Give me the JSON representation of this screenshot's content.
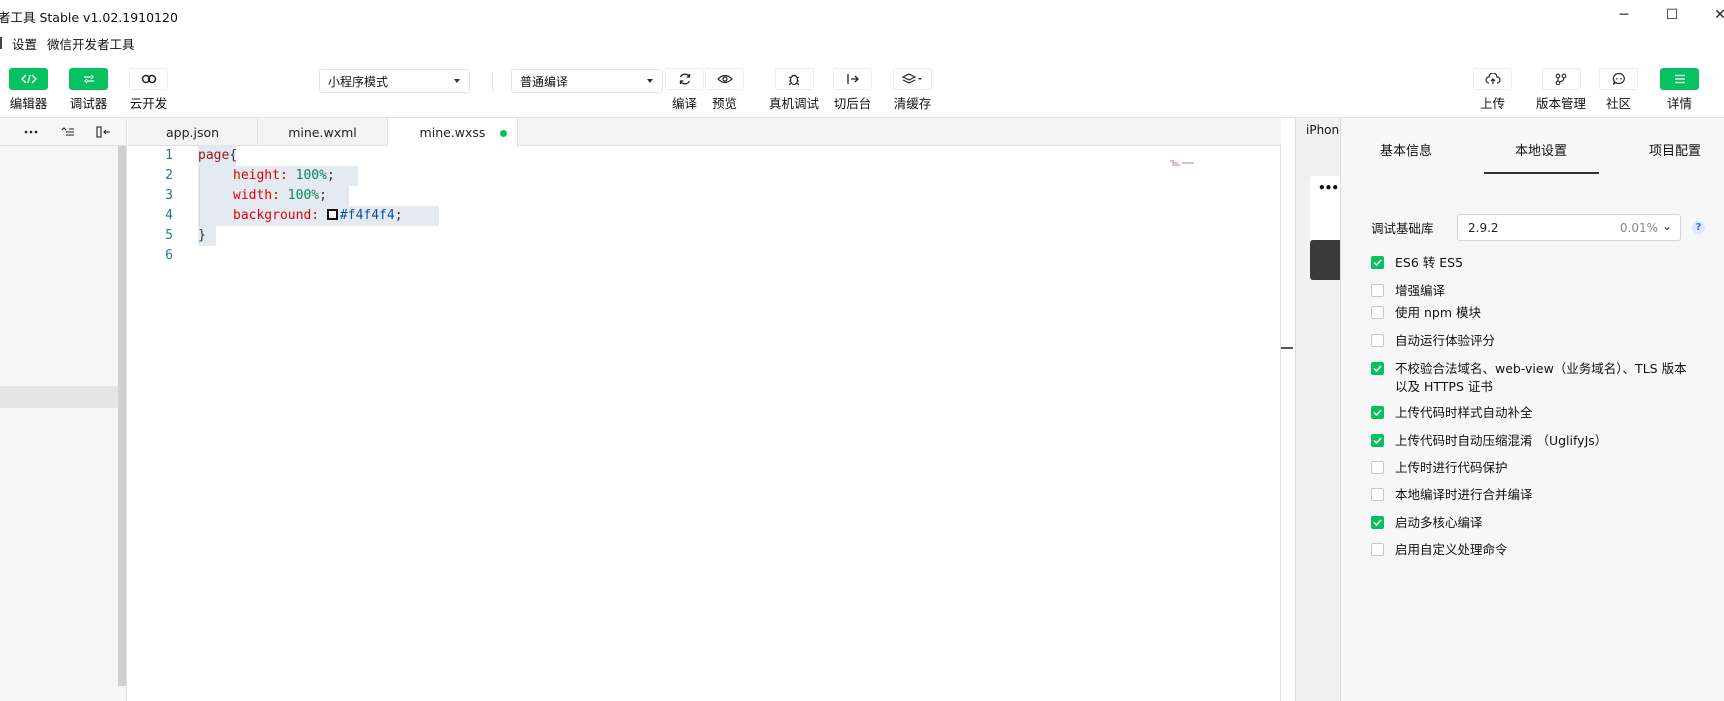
{
  "window": {
    "title": "者工具 Stable v1.02.1910120",
    "controls": {
      "minimize": "─",
      "maximize": "☐",
      "close": "✕"
    }
  },
  "menu": {
    "items": [
      "设置",
      "微信开发者工具"
    ]
  },
  "toolbar": {
    "editor_label": "编辑器",
    "debugger_label": "调试器",
    "cloud_label": "云开发",
    "mode_select": "小程序模式",
    "compile_select": "普通编译",
    "compile_label": "编译",
    "preview_label": "预览",
    "remote_debug_label": "真机调试",
    "background_label": "切后台",
    "clear_cache_label": "清缓存",
    "upload_label": "上传",
    "version_label": "版本管理",
    "community_label": "社区",
    "details_label": "详情",
    "accent": "#07c160"
  },
  "editor": {
    "tabs": [
      {
        "label": "app.json"
      },
      {
        "label": "mine.wxml"
      },
      {
        "label": "mine.wxss",
        "modified": true
      }
    ],
    "lines": [
      {
        "n": "1",
        "selector": "page",
        "open": "{"
      },
      {
        "n": "2",
        "prop": "height:",
        "val": "100%",
        "end": ";"
      },
      {
        "n": "3",
        "prop": "width:",
        "val": "100%",
        "end": ";"
      },
      {
        "n": "4",
        "prop": "background:",
        "val": "#f4f4f4",
        "end": ";"
      },
      {
        "n": "5",
        "close": "}"
      },
      {
        "n": "6"
      }
    ]
  },
  "simulator": {
    "device_tab": "iPhone",
    "status_dots": "•••"
  },
  "details": {
    "tabs": [
      "基本信息",
      "本地设置",
      "项目配置"
    ],
    "active_tab": "本地设置",
    "lib_label": "调试基础库",
    "lib_version": "2.9.2",
    "lib_percent": "0.01%",
    "help": "?",
    "options": [
      {
        "label": "ES6 转 ES5",
        "checked": true
      },
      {
        "label": "增强编译",
        "checked": false
      },
      {
        "label": "使用 npm 模块",
        "checked": false
      },
      {
        "label": "自动运行体验评分",
        "checked": false
      },
      {
        "label": "不校验合法域名、web-view（业务域名）、TLS 版本以及 HTTPS 证书",
        "checked": true
      },
      {
        "label": "上传代码时样式自动补全",
        "checked": true
      },
      {
        "label": "上传代码时自动压缩混淆 （UglifyJs）",
        "checked": true
      },
      {
        "label": "上传时进行代码保护",
        "checked": false
      },
      {
        "label": "本地编译时进行合并编译",
        "checked": false
      },
      {
        "label": "启动多核心编译",
        "checked": true
      },
      {
        "label": "启用自定义处理命令",
        "checked": false
      }
    ]
  }
}
